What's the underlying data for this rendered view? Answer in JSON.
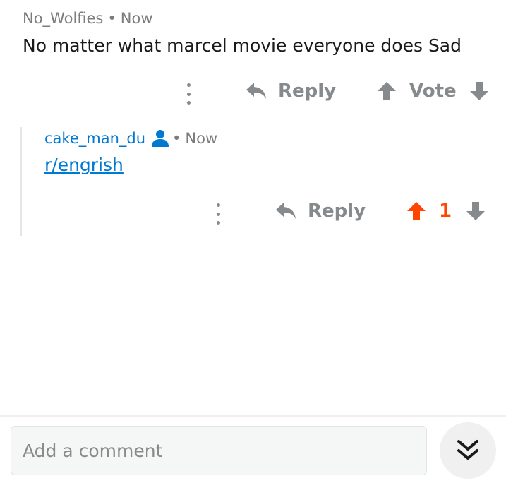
{
  "comments": [
    {
      "author": "No_Wolfies",
      "dot": "•",
      "time": "Now",
      "body": "No matter what marcel movie everyone does Sad",
      "actions": {
        "reply_label": "Reply",
        "vote_label": "Vote"
      },
      "icons": [
        "kebab-menu-icon",
        "reply-arrow-icon",
        "upvote-arrow-icon",
        "downvote-arrow-icon"
      ]
    },
    {
      "author": "cake_man_du",
      "dot": "•",
      "time": "Now",
      "body_link": "r/engrish",
      "actions": {
        "reply_label": "Reply",
        "score": "1"
      },
      "icons": [
        "user-icon",
        "kebab-menu-icon",
        "reply-arrow-icon",
        "upvote-arrow-icon",
        "downvote-arrow-icon"
      ]
    }
  ],
  "composer": {
    "placeholder": "Add a comment",
    "collapse_icon": "double-chevron-down-icon"
  },
  "colors": {
    "text_muted": "#878a8c",
    "link_blue": "#0079d3",
    "upvote_orange": "#ff4500"
  }
}
